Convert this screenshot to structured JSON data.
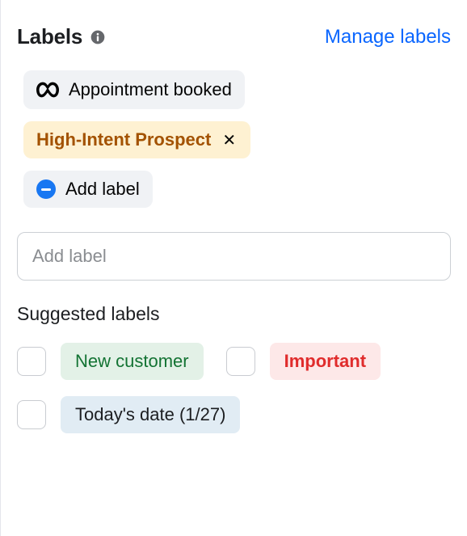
{
  "header": {
    "title": "Labels",
    "manage_link": "Manage labels"
  },
  "current_labels": [
    {
      "text": "Appointment booked",
      "icon": "meta",
      "style": "grey",
      "removable": false
    },
    {
      "text": "High-Intent Prospect",
      "icon": null,
      "style": "yellow",
      "removable": true
    }
  ],
  "add_label_chip": "Add label",
  "input": {
    "placeholder": "Add label"
  },
  "suggested_title": "Suggested labels",
  "suggested": [
    {
      "text": "New customer",
      "style": "green"
    },
    {
      "text": "Important",
      "style": "red"
    },
    {
      "text": "Today's date (1/27)",
      "style": "blue"
    }
  ]
}
